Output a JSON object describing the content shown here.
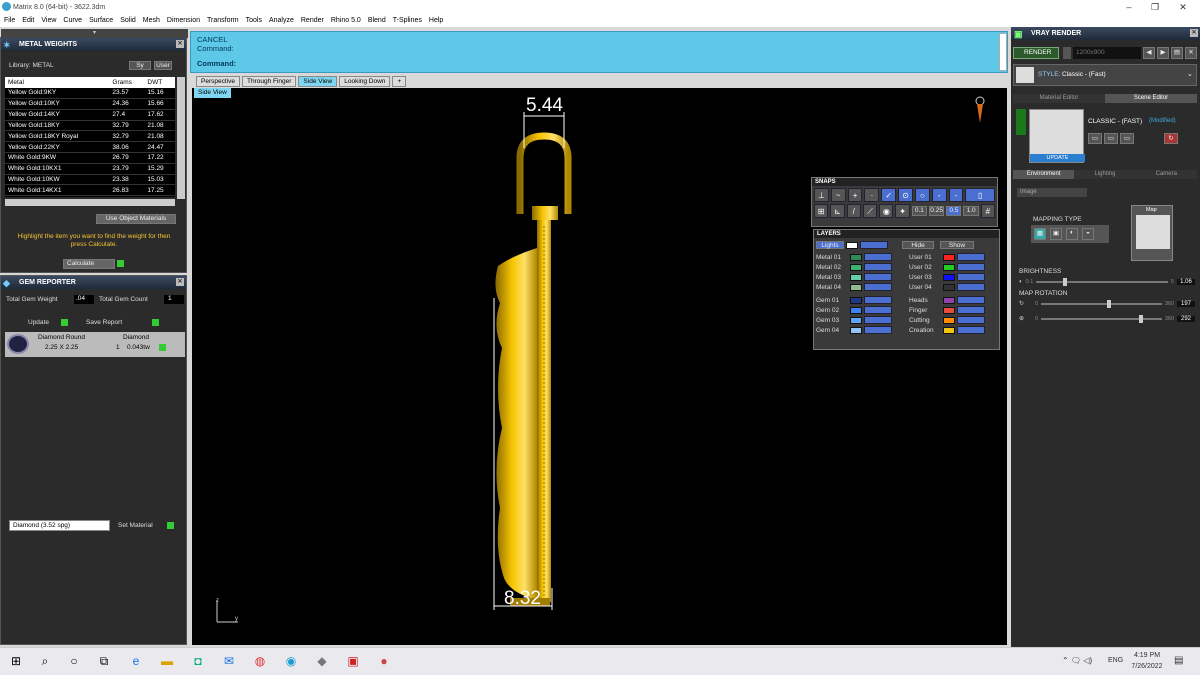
{
  "window": {
    "title": "Matrix 8.0 (64-bit) - 3622.3dm",
    "minimize": "–",
    "maximize": "❐",
    "close": "✕"
  },
  "menu": [
    "File",
    "Edit",
    "View",
    "Curve",
    "Surface",
    "Solid",
    "Mesh",
    "Dimension",
    "Transform",
    "Tools",
    "Analyze",
    "Render",
    "Rhino 5.0",
    "Blend",
    "T-Splines",
    "Help"
  ],
  "metal_weights": {
    "title": "METAL WEIGHTS",
    "library_label": "Library: METAL",
    "toggle_labels": [
      "Sy",
      "User"
    ],
    "columns": [
      "Metal",
      "Grams",
      "DWT"
    ],
    "rows": [
      [
        "Yellow Gold:9KY",
        "23.57",
        "15.16"
      ],
      [
        "Yellow Gold:10KY",
        "24.36",
        "15.66"
      ],
      [
        "Yellow Gold:14KY",
        "27.4",
        "17.62"
      ],
      [
        "Yellow Gold:18KY",
        "32.79",
        "21.08"
      ],
      [
        "Yellow Gold:18KY Royal",
        "32.79",
        "21.08"
      ],
      [
        "Yellow Gold:22KY",
        "38.06",
        "24.47"
      ],
      [
        "White Gold:9KW",
        "26.79",
        "17.22"
      ],
      [
        "White Gold:10KX1",
        "23.79",
        "15.29"
      ],
      [
        "White Gold:10KW",
        "23.38",
        "15.03"
      ],
      [
        "White Gold:14KX1",
        "26.83",
        "17.25"
      ]
    ],
    "use_object_materials": "Use Object Materials",
    "hint": "Highlight the item you want to find the weight for then press Calculate.",
    "calculate": "Calculate"
  },
  "gem_reporter": {
    "title": "GEM REPORTER",
    "total_weight_label": "Total Gem Weight",
    "total_weight": ".04",
    "total_count_label": "Total Gem Count",
    "total_count": "1",
    "update": "Update",
    "save_report": "Save Report",
    "gem_name": "Diamond Round",
    "gem_size": "2.25 X 2.25",
    "gem_type": "Diamond",
    "gem_qty": "1",
    "gem_tw": "0.043tw",
    "material_select": "Diamond   (3.52 spg)",
    "set_material": "Set Material"
  },
  "command": {
    "cancel": "CANCEL",
    "prompt": "Command:",
    "active": "Command:"
  },
  "view_tabs": [
    "Perspective",
    "Through Finger",
    "Side View",
    "Looking Down"
  ],
  "view_tab_active": "Side View",
  "viewport": {
    "label": "Side View",
    "dim_top": "5.44",
    "dim_bottom": "8.32",
    "axis_z": "z",
    "axis_y": "y"
  },
  "snaps": {
    "title": "SNAPS",
    "values": [
      "0.1",
      "0.25",
      "0.5",
      "1.0"
    ]
  },
  "layers": {
    "title": "LAYERS",
    "lights": "Lights",
    "hide": "Hide",
    "show": "Show",
    "left": [
      {
        "name": "Metal 01",
        "color": "#2e8b57"
      },
      {
        "name": "Metal 02",
        "color": "#3cb371"
      },
      {
        "name": "Metal 03",
        "color": "#66cdaa"
      },
      {
        "name": "Metal 04",
        "color": "#8fbc8f"
      },
      {
        "name": "Gem 01",
        "color": "#1e3a8a"
      },
      {
        "name": "Gem 02",
        "color": "#3b82f6"
      },
      {
        "name": "Gem 03",
        "color": "#60a5fa"
      },
      {
        "name": "Gem 04",
        "color": "#93c5fd"
      }
    ],
    "right": [
      {
        "name": "User 01",
        "color": "#ff2020"
      },
      {
        "name": "User 02",
        "color": "#22cc22"
      },
      {
        "name": "User 03",
        "color": "#1010ff"
      },
      {
        "name": "User 04",
        "color": "#333333"
      },
      {
        "name": "Heads",
        "color": "#8e44ad"
      },
      {
        "name": "Finger",
        "color": "#e74c3c"
      },
      {
        "name": "Cutting",
        "color": "#ff8c00"
      },
      {
        "name": "Creation",
        "color": "#f1c40f"
      }
    ]
  },
  "vray": {
    "title": "VRAY RENDER",
    "render": "RENDER",
    "resolution": "1200x900",
    "style_label": "STYLE:",
    "style_value": "Classic - (Fast)",
    "tabs": [
      "Material Editor",
      "Scene Editor"
    ],
    "preset": "CLASSIC - (FAST)",
    "modified": "(Modified)",
    "update": "UPDATE",
    "env_tabs": [
      "Environment",
      "Lighting",
      "Camera"
    ],
    "image_select": "Image",
    "mapping_type": "MAPPING TYPE",
    "map_label": "Map",
    "brightness": "BRIGHTNESS",
    "brightness_min": "0.1",
    "brightness_max": "5",
    "brightness_val": "1.06",
    "map_rotation": "MAP ROTATION",
    "rot1_min": "0",
    "rot1_max": "360",
    "rot1_val": "197",
    "rot2_min": "0",
    "rot2_max": "360",
    "rot2_val": "292"
  },
  "taskbar": {
    "time": "4:19 PM",
    "date": "7/26/2022",
    "lang": "ENG"
  }
}
